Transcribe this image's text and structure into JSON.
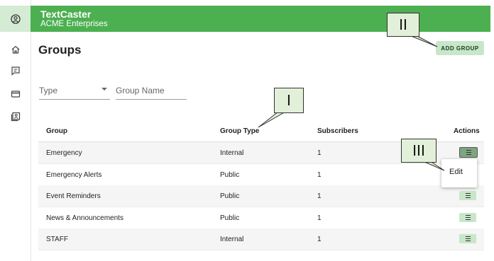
{
  "app": {
    "title": "TextCaster",
    "org": "ACME Enterprises"
  },
  "nav": {
    "icons": [
      "account-circle-icon",
      "home-icon",
      "messages-icon",
      "billing-card-icon",
      "contacts-icon"
    ]
  },
  "page": {
    "title": "Groups",
    "add_button": "ADD GROUP"
  },
  "filters": {
    "type_placeholder": "Type",
    "name_placeholder": "Group Name"
  },
  "table": {
    "headers": [
      "Group",
      "Group Type",
      "Subscribers",
      "Actions"
    ],
    "rows": [
      {
        "group": "Emergency",
        "type": "Internal",
        "subscribers": "1"
      },
      {
        "group": "Emergency Alerts",
        "type": "Public",
        "subscribers": "1"
      },
      {
        "group": "Event Reminders",
        "type": "Public",
        "subscribers": "1"
      },
      {
        "group": "News & Announcements",
        "type": "Public",
        "subscribers": "1"
      },
      {
        "group": "STAFF",
        "type": "Internal",
        "subscribers": "1"
      }
    ]
  },
  "menu": {
    "edit": "Edit"
  },
  "callouts": {
    "one": "I",
    "two": "II",
    "three": "III"
  },
  "colors": {
    "brand": "#4caf50",
    "button": "#c8e6c9",
    "callout": "#e2f0d9"
  }
}
